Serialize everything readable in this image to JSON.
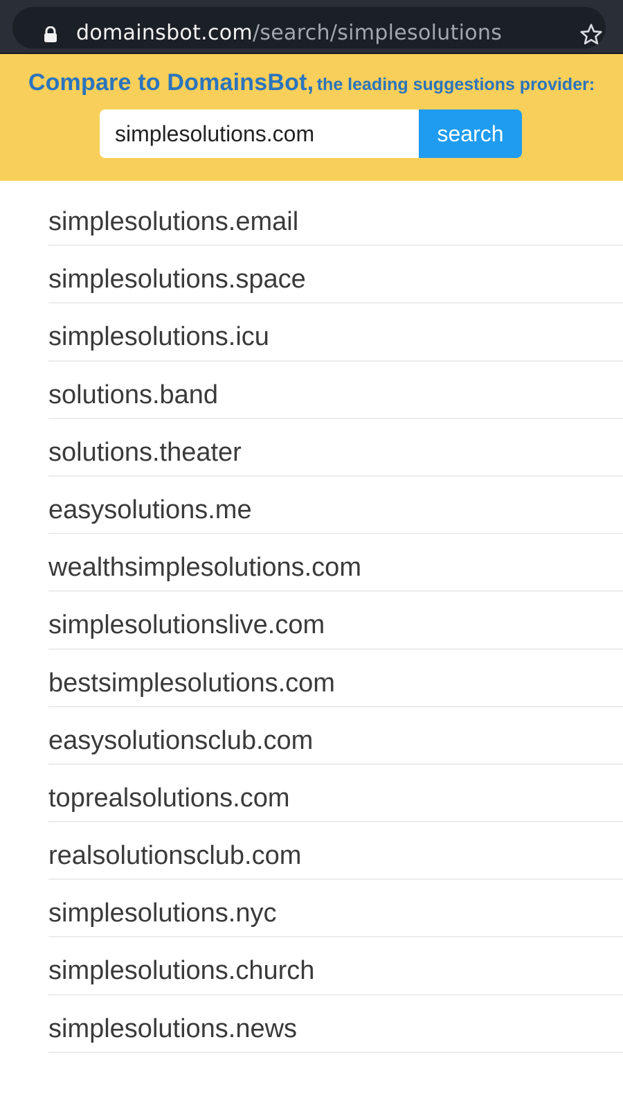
{
  "browser": {
    "url_domain": "domainsbot.com",
    "url_path": "/search/simplesolutions",
    "icons": {
      "lock": "lock-icon",
      "bookmark": "star-icon"
    }
  },
  "banner": {
    "heading_brand": "Compare to DomainsBot,",
    "heading_sub": "the leading suggestions provider:",
    "search_value": "simplesolutions.com",
    "search_button_label": "search",
    "colors": {
      "background": "#f7cf5a",
      "heading": "#2b74bd",
      "button": "#1f9cf0"
    }
  },
  "results": [
    "simplesolutions.email",
    "simplesolutions.space",
    "simplesolutions.icu",
    "solutions.band",
    "solutions.theater",
    "easysolutions.me",
    "wealthsimplesolutions.com",
    "simplesolutionslive.com",
    "bestsimplesolutions.com",
    "easysolutionsclub.com",
    "toprealsolutions.com",
    "realsolutionsclub.com",
    "simplesolutions.nyc",
    "simplesolutions.church",
    "simplesolutions.news"
  ]
}
